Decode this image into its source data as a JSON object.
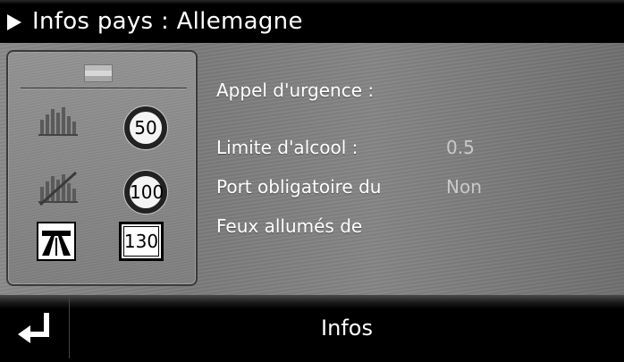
{
  "title": {
    "text": "Infos pays : Allemagne",
    "icon": "play-triangle-icon"
  },
  "panel": {
    "flag_icon": "germany-flag-icon",
    "rows": [
      {
        "icon": "town-buildings-icon",
        "speed": "50"
      },
      {
        "icon": "rural-road-icon",
        "speed": "100"
      },
      {
        "icon": "motorway-icon",
        "speed": "130"
      }
    ]
  },
  "info": {
    "emergency_label": "Appel d'urgence :",
    "alcohol_label": "Limite d'alcool :",
    "alcohol_value": "0.5",
    "mandatory_label": "Port obligatoire du",
    "mandatory_value": "Non",
    "lights_label": "Feux allumés de"
  },
  "footer": {
    "back_icon": "return-arrow-icon",
    "title": "Infos"
  },
  "colors": {
    "background": "#808080",
    "bar": "#000000",
    "text": "#ffffff",
    "value_text": "#c9c9c9"
  }
}
